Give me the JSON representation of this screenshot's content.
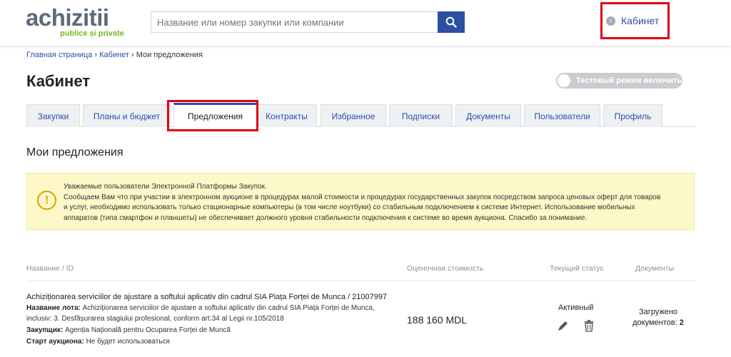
{
  "logo": {
    "main": "achizitii",
    "sub": "publice și private"
  },
  "search": {
    "placeholder": "Название или номер закупки или компании",
    "icon": "search-icon"
  },
  "header": {
    "cabinet_label": "Кабинет"
  },
  "breadcrumb": {
    "home": "Главная страница",
    "sep": " › ",
    "cabinet": "Кабинет",
    "current": "Мои предложения"
  },
  "page": {
    "title": "Кабинет",
    "test_mode": "Тестовый режим включить",
    "section_title": "Мои предложения"
  },
  "tabs": [
    {
      "label": "Закупки"
    },
    {
      "label": "Планы и бюджет"
    },
    {
      "label": "Предложения"
    },
    {
      "label": "Контракты"
    },
    {
      "label": "Избранное"
    },
    {
      "label": "Подписки"
    },
    {
      "label": "Документы"
    },
    {
      "label": "Пользователи"
    },
    {
      "label": "Профиль"
    }
  ],
  "active_tab": "Предложения",
  "notice": {
    "lines": [
      "Уважаемые пользователи Электронной Платформы Закупок.",
      "Сообщаем Вам что при участии в электронном аукционе в процедурах малой стоимости и процедурах государственных закупок посредством запроса ценовых оферт для товаров",
      "и услуг, необходимо использовать только стационарные компьютеры (в том числе ноутбуки) со стабильным подключением к системе Интернет. Использование мобильных",
      "аппаратов (типа смартфон и планшеты) не обеспечивает должного уровня стабильности подключения к системе во время аукциона. Спасибо за понимание."
    ]
  },
  "table": {
    "headers": {
      "name": "Название / ID",
      "cost": "Оценочная стоимость",
      "status": "Текущий статус",
      "docs": "Документы"
    },
    "row": {
      "title": "Achiziționarea serviciilor de ajustare a softului aplicativ din cadrul SIA Piața Forței de Munca / 21007997",
      "lot_label": "Название лота:",
      "lot_value_1": " Achiziționarea serviciilor de ajustare a softului aplicativ din cadrul SIA Piața Forței de Munca,",
      "lot_value_2": "inclusiv: 3. Desfășurarea stagiului profesional, conform art.34 al Legii nr.105/2018",
      "buyer_label": "Закупщик:",
      "buyer_value": " Agenția Națională pentru Ocuparea Forței de Muncă",
      "start_label": "Старт аукциона:",
      "start_value": " Не будет использоваться",
      "cost": "188 160 MDL",
      "status": "Активный",
      "docs_line1": "Загружено",
      "docs_line2": "документов:",
      "docs_count": "2"
    }
  },
  "colors": {
    "brand": "#2c4fa3",
    "highlight": "#e0000f",
    "notice_bg": "#fdf8c8",
    "logo_green": "#7ab829"
  }
}
